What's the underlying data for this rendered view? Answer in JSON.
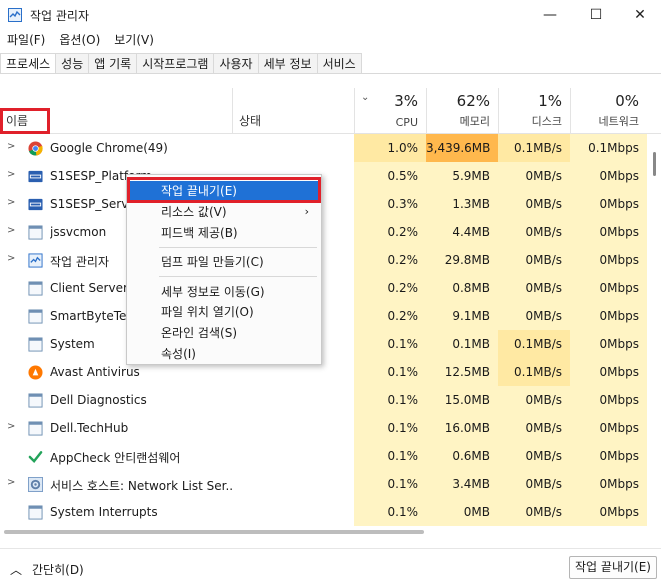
{
  "window": {
    "title": "작업 관리자",
    "min_glyph": "—",
    "max_glyph": "☐",
    "close_glyph": "✕"
  },
  "menu": [
    "파일(F)",
    "옵션(O)",
    "보기(V)"
  ],
  "tabs": [
    "프로세스",
    "성능",
    "앱 기록",
    "시작프로그램",
    "사용자",
    "세부 정보",
    "서비스"
  ],
  "header": {
    "name": "이름",
    "status": "상태",
    "cpu": {
      "pct": "3%",
      "label": "CPU"
    },
    "mem": {
      "pct": "62%",
      "label": "메모리"
    },
    "disk": {
      "pct": "1%",
      "label": "디스크"
    },
    "net": {
      "pct": "0%",
      "label": "네트워크"
    }
  },
  "processes": [
    {
      "name": "Google Chrome(49)",
      "icon": "chrome-icon",
      "expandable": true,
      "cpu": "1.0%",
      "mem": "3,439.6MB",
      "disk": "0.1MB/s",
      "net": "0.1Mbps"
    },
    {
      "name": "S1SESP_Platform",
      "icon": "s1sesp-icon",
      "expandable": true,
      "cpu": "0.5%",
      "mem": "5.9MB",
      "disk": "0MB/s",
      "net": "0Mbps"
    },
    {
      "name": "S1SESP_Servic",
      "icon": "s1sesp-icon",
      "expandable": true,
      "cpu": "0.3%",
      "mem": "1.3MB",
      "disk": "0MB/s",
      "net": "0Mbps"
    },
    {
      "name": "jssvcmon",
      "icon": "app-icon",
      "expandable": true,
      "cpu": "0.2%",
      "mem": "4.4MB",
      "disk": "0MB/s",
      "net": "0Mbps"
    },
    {
      "name": "작업 관리자",
      "icon": "task-manager-icon",
      "expandable": true,
      "cpu": "0.2%",
      "mem": "29.8MB",
      "disk": "0MB/s",
      "net": "0Mbps"
    },
    {
      "name": "Client Server I",
      "icon": "app-icon",
      "expandable": false,
      "cpu": "0.2%",
      "mem": "0.8MB",
      "disk": "0MB/s",
      "net": "0Mbps"
    },
    {
      "name": "SmartByteTele",
      "icon": "app-icon",
      "expandable": false,
      "cpu": "0.2%",
      "mem": "9.1MB",
      "disk": "0MB/s",
      "net": "0Mbps"
    },
    {
      "name": "System",
      "icon": "app-icon",
      "expandable": false,
      "cpu": "0.1%",
      "mem": "0.1MB",
      "disk": "0.1MB/s",
      "net": "0Mbps"
    },
    {
      "name": "Avast Antivirus",
      "icon": "avast-icon",
      "expandable": false,
      "cpu": "0.1%",
      "mem": "12.5MB",
      "disk": "0.1MB/s",
      "net": "0Mbps"
    },
    {
      "name": "Dell Diagnostics",
      "icon": "app-icon",
      "expandable": false,
      "cpu": "0.1%",
      "mem": "15.0MB",
      "disk": "0MB/s",
      "net": "0Mbps"
    },
    {
      "name": "Dell.TechHub",
      "icon": "app-icon",
      "expandable": true,
      "cpu": "0.1%",
      "mem": "16.0MB",
      "disk": "0MB/s",
      "net": "0Mbps"
    },
    {
      "name": "AppCheck 안티랜섬웨어",
      "icon": "appcheck-icon",
      "expandable": false,
      "cpu": "0.1%",
      "mem": "0.6MB",
      "disk": "0MB/s",
      "net": "0Mbps"
    },
    {
      "name": "서비스 호스트: Network List Ser...",
      "icon": "gear-icon",
      "expandable": true,
      "cpu": "0.1%",
      "mem": "3.4MB",
      "disk": "0MB/s",
      "net": "0Mbps"
    },
    {
      "name": "System Interrupts",
      "icon": "app-icon",
      "expandable": false,
      "cpu": "0.1%",
      "mem": "0MB",
      "disk": "0MB/s",
      "net": "0Mbps"
    }
  ],
  "context_menu": {
    "end_task": "작업 끝내기(E)",
    "resource_values": "리소스 값(V)",
    "feedback": "피드백 제공(B)",
    "dump": "덤프 파일 만들기(C)",
    "go_details": "세부 정보로 이동(G)",
    "open_location": "파일 위치 열기(O)",
    "search_online": "온라인 검색(S)",
    "properties": "속성(I)"
  },
  "footer": {
    "fewer_details": "간단히(D)",
    "end_task_button": "작업 끝내기(E)"
  },
  "colors": {
    "heat_light": "#fff4c4",
    "heat_medium": "#ffe9a3",
    "heat_strong": "#ffb84d",
    "highlight": "#1f71d6",
    "annotation_red": "#e0202a"
  }
}
